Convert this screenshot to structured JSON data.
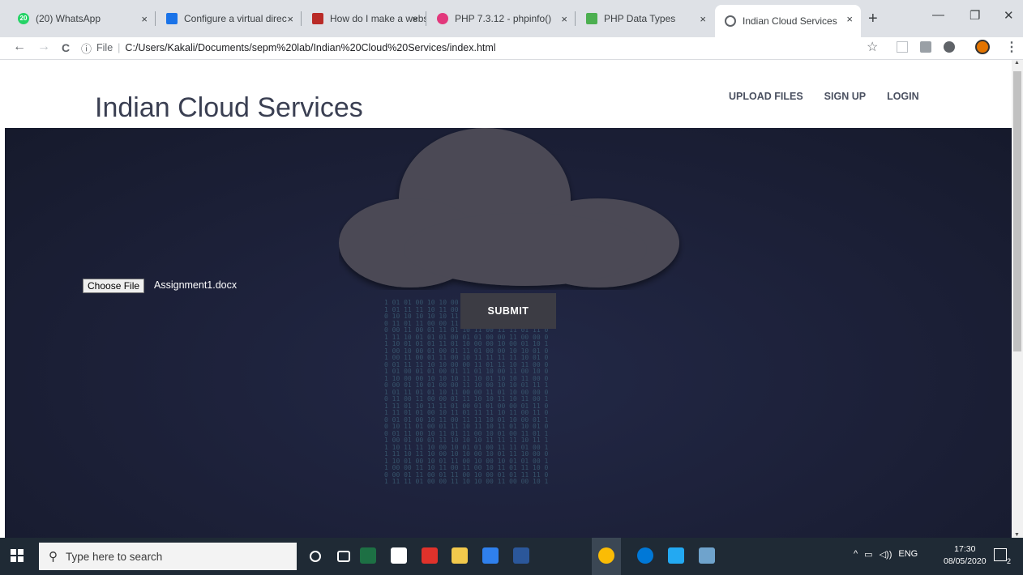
{
  "browser": {
    "tabs": [
      {
        "title": "(20) WhatsApp",
        "favicon": "whatsapp-icon",
        "color": "#25d366",
        "badge": "20",
        "active": false
      },
      {
        "title": "Configure a virtual direc",
        "favicon": "ninja-icon",
        "color": "#1a73e8",
        "active": false
      },
      {
        "title": "How do I make a websi",
        "favicon": "quora-icon",
        "color": "#b92b27",
        "active": false
      },
      {
        "title": "PHP 7.3.12 - phpinfo()",
        "favicon": "php-icon",
        "color": "#e2387c",
        "active": false
      },
      {
        "title": "PHP Data Types",
        "favicon": "w3schools-icon",
        "color": "#4caf50",
        "active": false
      },
      {
        "title": "Indian Cloud Services",
        "favicon": "globe-icon",
        "color": "#5f6368",
        "active": true
      }
    ],
    "close_glyph": "×",
    "new_tab_glyph": "+",
    "window_controls": {
      "minimize": "—",
      "maximize": "❐",
      "close": "✕"
    },
    "nav": {
      "back": "←",
      "forward": "→",
      "reload": "C"
    },
    "address": {
      "info_glyph": "ⓘ",
      "scheme": "File",
      "separator": "|",
      "url": "C:/Users/Kakali/Documents/sepm%20lab/Indian%20Cloud%20Services/index.html"
    },
    "toolbar_icons": [
      "star-icon",
      "extension-icon",
      "clipboard-icon",
      "vpn-icon",
      "avatar-icon",
      "menu-icon"
    ],
    "toolbar_glyphs": {
      "star": "☆",
      "menu": "⋮"
    }
  },
  "page": {
    "site_title": "Indian Cloud Services",
    "nav": [
      "UPLOAD FILES",
      "SIGN UP",
      "LOGIN"
    ],
    "file_input": {
      "button_label": "Choose File",
      "file_name": "Assignment1.docx"
    },
    "submit_label": "SUBMIT",
    "rain_text": "1 01 01 00 10 10 00 01 10 10 11 00 11 00 0\n1 01 11 11 10 11 00 11 00 10 11 00 11 10 0\n0 10 10 10 10 10 11 11 00 01 01 11 10 10 0\n0 11 01 11 00 00 11 01 10 11 01 00 10 00 1\n0 00 11 00 01 11 01 10 11 00 11 11 01 11 0\n1 11 10 01 01 01 00 01 01 00 00 11 00 00 0\n1 10 01 01 01 11 01 10 00 00 10 00 01 10 1\n1 00 10 00 01 00 01 11 01 00 00 10 10 01 0\n1 00 11 00 01 11 00 10 11 11 11 11 10 01 0\n0 01 11 11 10 10 00 00 11 01 11 10 11 00 0\n1 01 00 01 01 00 01 11 01 10 00 11 00 10 0\n1 10 00 00 10 10 10 11 10 01 10 10 11 00 0\n0 00 01 10 01 00 00 11 10 00 10 10 01 11 1\n1 01 11 01 01 10 11 00 00 11 01 10 00 00 0\n0 11 00 11 00 00 01 11 10 10 11 10 11 00 1\n1 11 01 10 11 11 01 00 01 01 00 00 01 11 0\n1 11 01 01 00 10 11 01 11 11 10 11 00 11 0\n0 01 01 00 10 11 00 11 11 10 01 10 00 01 1\n0 10 11 01 00 01 11 10 11 10 11 01 10 01 0\n0 01 11 00 10 11 01 11 00 10 01 00 11 01 1\n1 00 01 00 01 11 10 10 10 11 11 11 10 11 1\n1 10 11 11 10 00 10 01 01 00 11 11 01 00 1\n1 11 10 11 10 00 10 10 00 10 01 11 10 00 0\n1 10 01 00 10 01 11 00 10 00 10 01 01 00 1\n1 00 00 11 10 11 00 11 00 10 11 01 11 10 0\n0 00 01 11 00 01 11 00 10 00 01 01 11 11 0\n1 11 11 01 00 00 11 10 10 00 11 00 00 10 1",
    "rain_text_html": ""
  },
  "taskbar": {
    "search_placeholder": "Type here to search",
    "search_glyph": "⚲",
    "apps": [
      "cortana-icon",
      "task-view-icon",
      "excel-icon",
      "store-icon",
      "acrobat-icon",
      "file-explorer-icon",
      "mail-icon",
      "word-icon",
      "chrome-icon",
      "edge-icon",
      "vscode-icon",
      "notepad-icon"
    ],
    "tray": {
      "chevron": "^",
      "battery": "▭",
      "volume": "◁))",
      "lang": "ENG"
    },
    "time": "17:30",
    "date": "08/05/2020",
    "notification_count": "2"
  }
}
